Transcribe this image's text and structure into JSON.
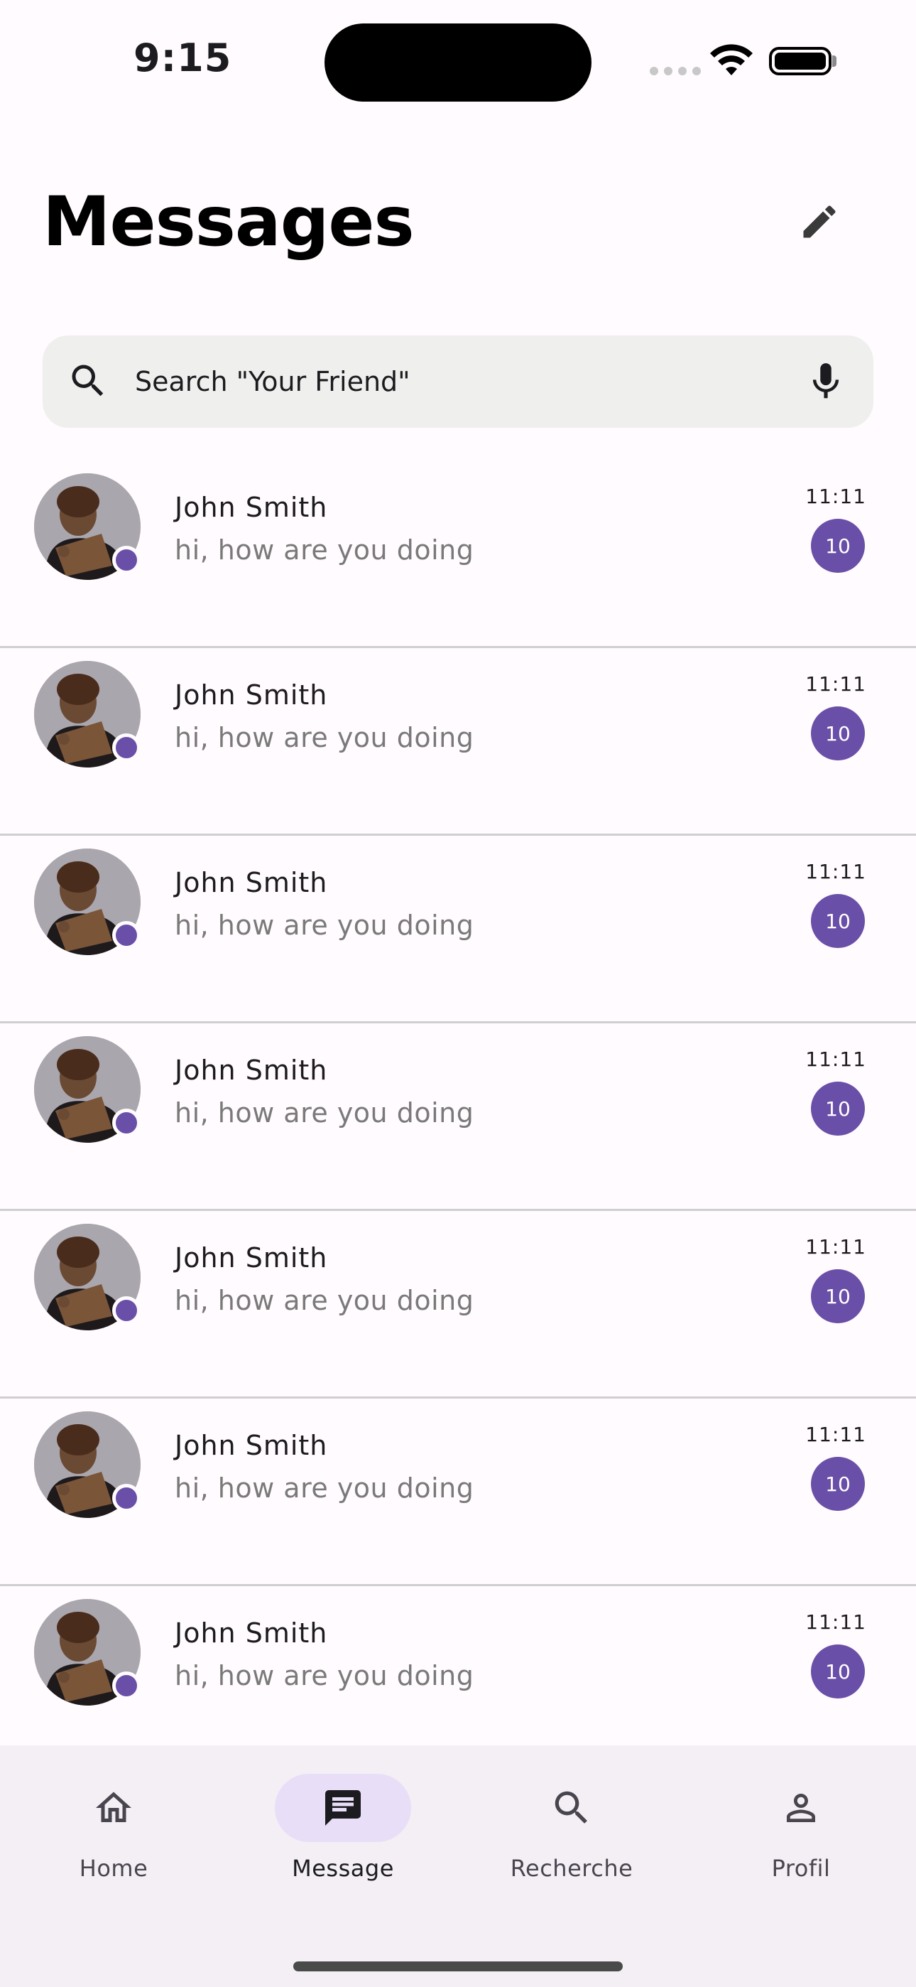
{
  "status_bar": {
    "time": "9:15"
  },
  "header": {
    "title": "Messages",
    "compose_icon": "pencil-icon"
  },
  "search": {
    "placeholder": "Search \"Your Friend\"",
    "value": "",
    "left_icon": "search-icon",
    "right_icon": "microphone-icon"
  },
  "conversations": [
    {
      "name": "John Smith",
      "message": "hi, how are you doing",
      "time": "11:11",
      "unread": "10",
      "online": true
    },
    {
      "name": "John Smith",
      "message": "hi, how are you doing",
      "time": "11:11",
      "unread": "10",
      "online": true
    },
    {
      "name": "John Smith",
      "message": "hi, how are you doing",
      "time": "11:11",
      "unread": "10",
      "online": true
    },
    {
      "name": "John Smith",
      "message": "hi, how are you doing",
      "time": "11:11",
      "unread": "10",
      "online": true
    },
    {
      "name": "John Smith",
      "message": "hi, how are you doing",
      "time": "11:11",
      "unread": "10",
      "online": true
    },
    {
      "name": "John Smith",
      "message": "hi, how are you doing",
      "time": "11:11",
      "unread": "10",
      "online": true
    },
    {
      "name": "John Smith",
      "message": "hi, how are you doing",
      "time": "11:11",
      "unread": "10",
      "online": true
    }
  ],
  "bottom_nav": {
    "items": [
      {
        "label": "Home",
        "icon": "home-icon",
        "active": false
      },
      {
        "label": "Message",
        "icon": "message-icon",
        "active": true
      },
      {
        "label": "Recherche",
        "icon": "search-icon",
        "active": false
      },
      {
        "label": "Profil",
        "icon": "profile-icon",
        "active": false
      }
    ]
  },
  "colors": {
    "accent": "#6a4fa8",
    "active_pill": "#e9def8",
    "search_bg": "#eff0ee",
    "nav_bg": "#f3eff4",
    "background": "#fffbfe"
  }
}
